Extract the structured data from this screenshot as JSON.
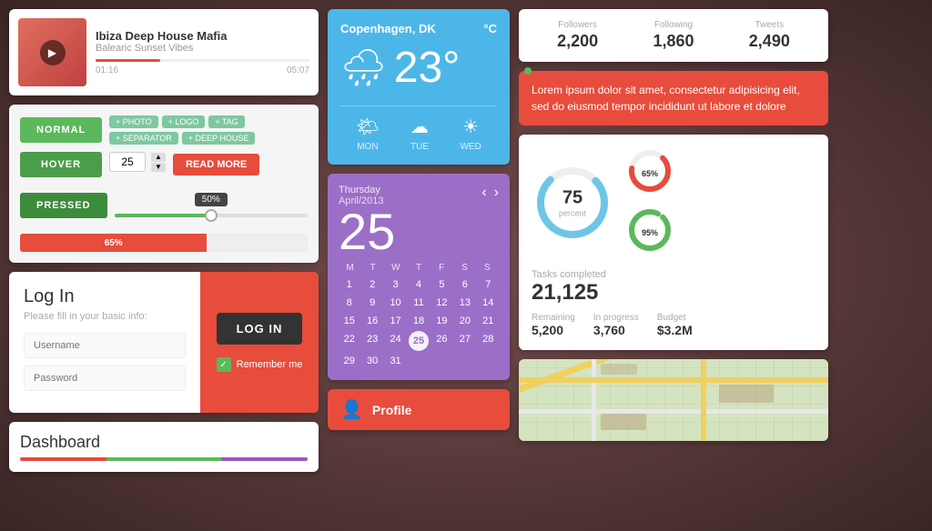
{
  "music": {
    "title": "Ibiza Deep House Mafia",
    "subtitle": "Balearic Sunset Vibes",
    "time_current": "01:16",
    "time_total": "05:07",
    "progress_pct": 30
  },
  "buttons": {
    "normal_label": "NORMAL",
    "hover_label": "HOVER",
    "pressed_label": "PRESSED",
    "read_more_label": "READ MORE",
    "tags": [
      "+ PHOTO",
      "+ LOGO",
      "+ TAG",
      "+ SEPARATOR",
      "+ DEEP HOUSE"
    ],
    "spinner_value": "25",
    "slider_pct": "50%",
    "progress_pct": "65%"
  },
  "login": {
    "title": "Log In",
    "subtitle": "Please fill in your basic info:",
    "username_placeholder": "Username",
    "password_placeholder": "Password",
    "login_btn": "LOG IN",
    "remember_label": "Remember me"
  },
  "dashboard": {
    "title": "Dashboard"
  },
  "weather": {
    "location": "Copenhagen, DK",
    "unit": "°C",
    "temp": "23°",
    "days": [
      "MON",
      "TUE",
      "WED"
    ],
    "icons": [
      "🌤",
      "☁",
      "☀"
    ]
  },
  "calendar": {
    "day_name": "Thursday",
    "month_year": "April/2013",
    "date": "25",
    "weekdays": [
      "M",
      "T",
      "W",
      "T",
      "F",
      "S",
      "S"
    ],
    "weeks": [
      [
        "1",
        "2",
        "3",
        "4",
        "5",
        "6",
        "7"
      ],
      [
        "8",
        "9",
        "10",
        "11",
        "12",
        "13",
        "14"
      ],
      [
        "15",
        "16",
        "17",
        "18",
        "19",
        "20",
        "21"
      ],
      [
        "22",
        "23",
        "24",
        "25",
        "26",
        "27",
        "28"
      ],
      [
        "29",
        "30",
        "31",
        "",
        "",
        "",
        ""
      ]
    ],
    "today": "25"
  },
  "profile": {
    "label": "Profile"
  },
  "twitter": {
    "followers_label": "Followers",
    "followers_value": "2,200",
    "following_label": "Following",
    "following_value": "1,860",
    "tweets_label": "Tweets",
    "tweets_value": "2,490"
  },
  "tooltip": {
    "text": "Lorem ipsum dolor sit amet, consectetur adipisicing elit, sed do eiusmod tempor incididunt ut labore et dolore"
  },
  "stats": {
    "donut_main_value": "75",
    "donut_main_label": "percent",
    "donut1_pct": 65,
    "donut1_label": "65%",
    "donut2_pct": 95,
    "donut2_label": "95%",
    "tasks_label": "Tasks completed",
    "tasks_value": "21,125",
    "remaining_label": "Remaining",
    "remaining_value": "5,200",
    "in_progress_label": "In progress",
    "in_progress_value": "3,760",
    "budget_label": "Budget",
    "budget_value": "$3.2M"
  },
  "colors": {
    "green": "#5cb85c",
    "red": "#e74c3c",
    "blue": "#4db6e8",
    "purple": "#9b6fc7",
    "donut_main": "#6ec6e6",
    "donut1": "#e74c3c",
    "donut2": "#5cb85c"
  }
}
